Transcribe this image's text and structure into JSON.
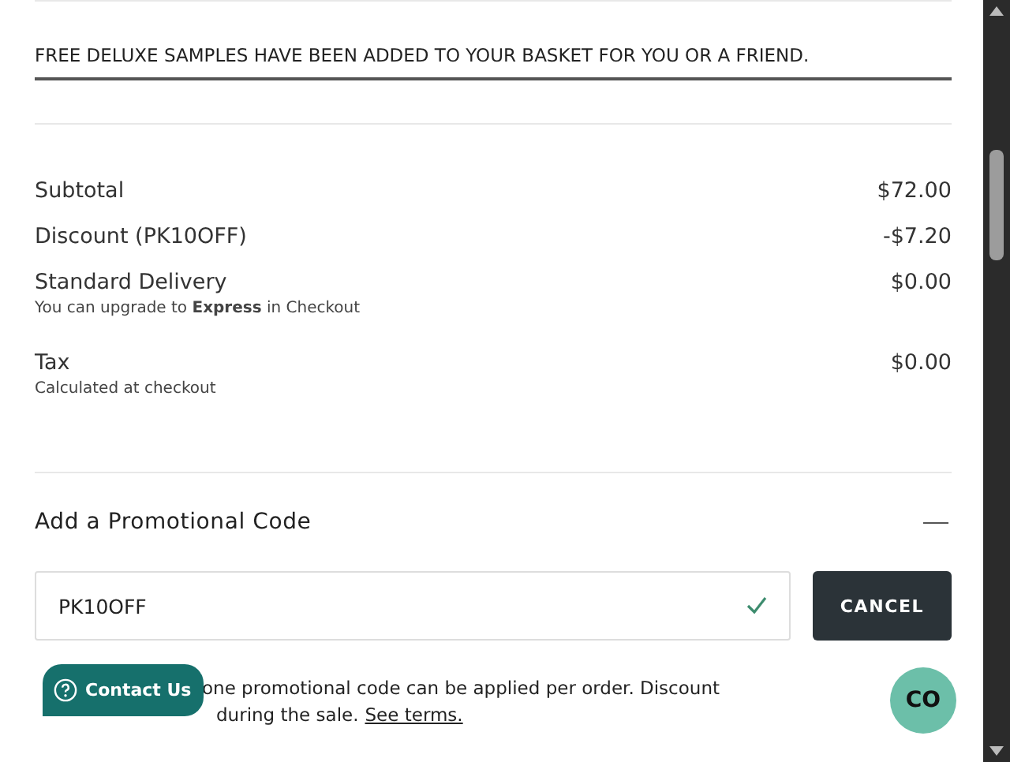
{
  "banner": {
    "text": "FREE DELUXE SAMPLES HAVE BEEN ADDED TO YOUR BASKET FOR YOU OR A FRIEND."
  },
  "summary": [
    {
      "label": "Subtotal",
      "value": "$72.00"
    },
    {
      "label": "Discount (PK10OFF)",
      "value": "-$7.20"
    },
    {
      "label": "Standard Delivery",
      "value": "$0.00",
      "note": "You can upgrade to **Express** in Checkout"
    },
    {
      "label": "Tax",
      "value": "$0.00",
      "note": "Calculated at checkout"
    }
  ],
  "promo": {
    "title": "Add a Promotional Code",
    "expanded": true,
    "value": "PK10OFF",
    "valid": true,
    "button": "CANCEL",
    "notice_lines": [
      "one promotional code can be applied per order. Discount",
      "during the sale."
    ],
    "terms_link": "See terms."
  },
  "contact_button": {
    "label": "Contact Us"
  },
  "chat_button": {
    "label": "CO"
  }
}
